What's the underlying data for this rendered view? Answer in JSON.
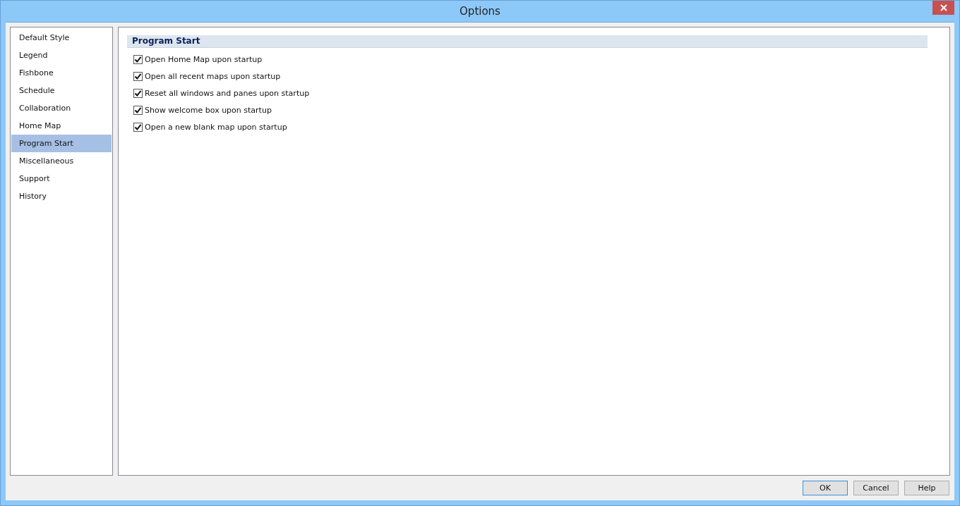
{
  "window": {
    "title": "Options"
  },
  "sidebar": {
    "items": [
      {
        "label": "Default Style",
        "selected": false
      },
      {
        "label": "Legend",
        "selected": false
      },
      {
        "label": "Fishbone",
        "selected": false
      },
      {
        "label": "Schedule",
        "selected": false
      },
      {
        "label": "Collaboration",
        "selected": false
      },
      {
        "label": "Home Map",
        "selected": false
      },
      {
        "label": "Program Start",
        "selected": true
      },
      {
        "label": "Miscellaneous",
        "selected": false
      },
      {
        "label": "Support",
        "selected": false
      },
      {
        "label": "History",
        "selected": false
      }
    ]
  },
  "section": {
    "title": "Program Start",
    "options": [
      {
        "label": "Open Home Map upon startup",
        "checked": true
      },
      {
        "label": "Open all recent maps upon startup",
        "checked": true
      },
      {
        "label": "Reset all windows and panes upon startup",
        "checked": true
      },
      {
        "label": "Show welcome box upon startup",
        "checked": true
      },
      {
        "label": "Open a new blank map upon startup",
        "checked": true
      }
    ]
  },
  "buttons": [
    {
      "label": "OK",
      "default": true
    },
    {
      "label": "Cancel",
      "default": false
    },
    {
      "label": "Help",
      "default": false
    }
  ]
}
